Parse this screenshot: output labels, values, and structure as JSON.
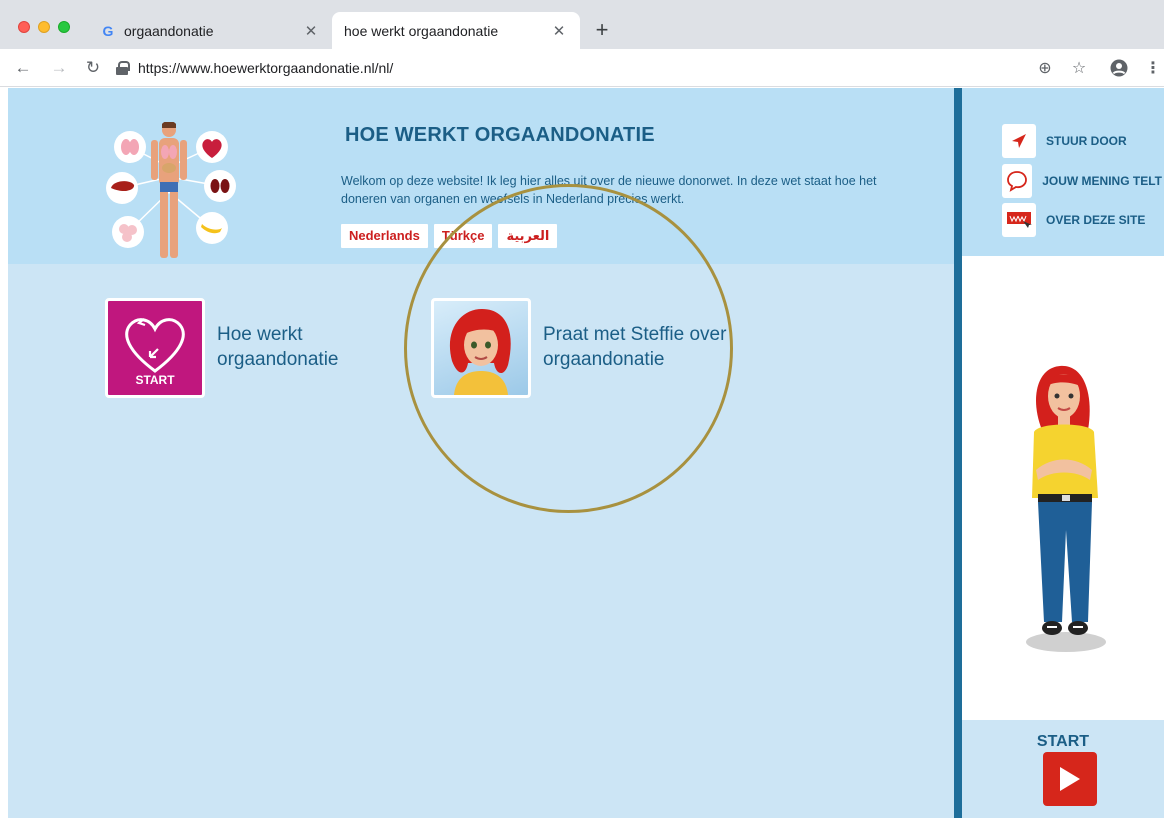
{
  "browser": {
    "tabs": [
      {
        "title": "orgaandonatie",
        "favicon": "google-g-icon",
        "active": false
      },
      {
        "title": "hoe werkt orgaandonatie",
        "active": true
      }
    ],
    "url": "https://www.hoewerktorgaandonatie.nl/nl/"
  },
  "header": {
    "title": "HOE WERKT ORGAANDONATIE",
    "intro": "Welkom op deze website! Ik leg hier alles uit over de nieuwe donorwet. In deze wet staat hoe het doneren van organen en weefsels in Nederland precies werkt.",
    "languages": [
      "Nederlands",
      "Türkçe",
      "العربية"
    ]
  },
  "cards": [
    {
      "label": "Hoe werkt orgaandonatie",
      "badge": "START",
      "icon": "heart-icon"
    },
    {
      "label": "Praat met Steffie over orgaandonatie",
      "icon": "steffie-avatar"
    }
  ],
  "sidebar": {
    "links": [
      {
        "label": "STUUR DOOR",
        "icon": "send-icon"
      },
      {
        "label": "JOUW MENING TELT",
        "icon": "speech-bubble-icon"
      },
      {
        "label": "OVER DEZE SITE",
        "icon": "www-icon"
      }
    ],
    "start_label": "START"
  },
  "colors": {
    "header_blue": "#b9dff5",
    "page_blue": "#cce5f5",
    "title_blue": "#1b5e86",
    "accent_red": "#d6261b",
    "card_magenta": "#c0177e",
    "highlight_gold": "#a8913f"
  }
}
